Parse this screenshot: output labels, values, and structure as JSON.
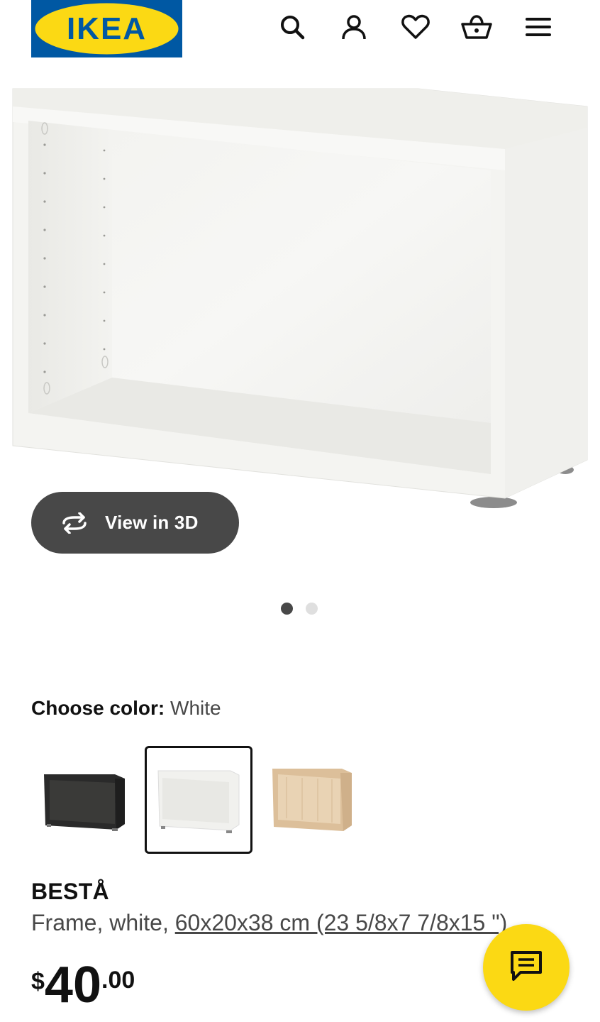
{
  "header": {
    "logo_text": "IKEA",
    "icons": [
      "search-icon",
      "account-icon",
      "heart-icon",
      "cart-icon",
      "menu-icon"
    ]
  },
  "gallery": {
    "view3d_label": "View in 3D",
    "current_slide": 1,
    "total_slides": 2
  },
  "color_chooser": {
    "label": "Choose color:",
    "selected_value": "White",
    "options": [
      "Black-brown",
      "White",
      "White stained oak effect"
    ]
  },
  "product": {
    "name": "BESTÅ",
    "description_prefix": "Frame, white, ",
    "dimensions": "60x20x38 cm (23 5/8x7 7/8x15 \")",
    "price_currency": "$",
    "price_integer": "40",
    "price_decimal": ".00"
  },
  "colors": {
    "brand_blue": "#0058a3",
    "brand_yellow": "#fbd914",
    "button_dark": "#484848"
  }
}
